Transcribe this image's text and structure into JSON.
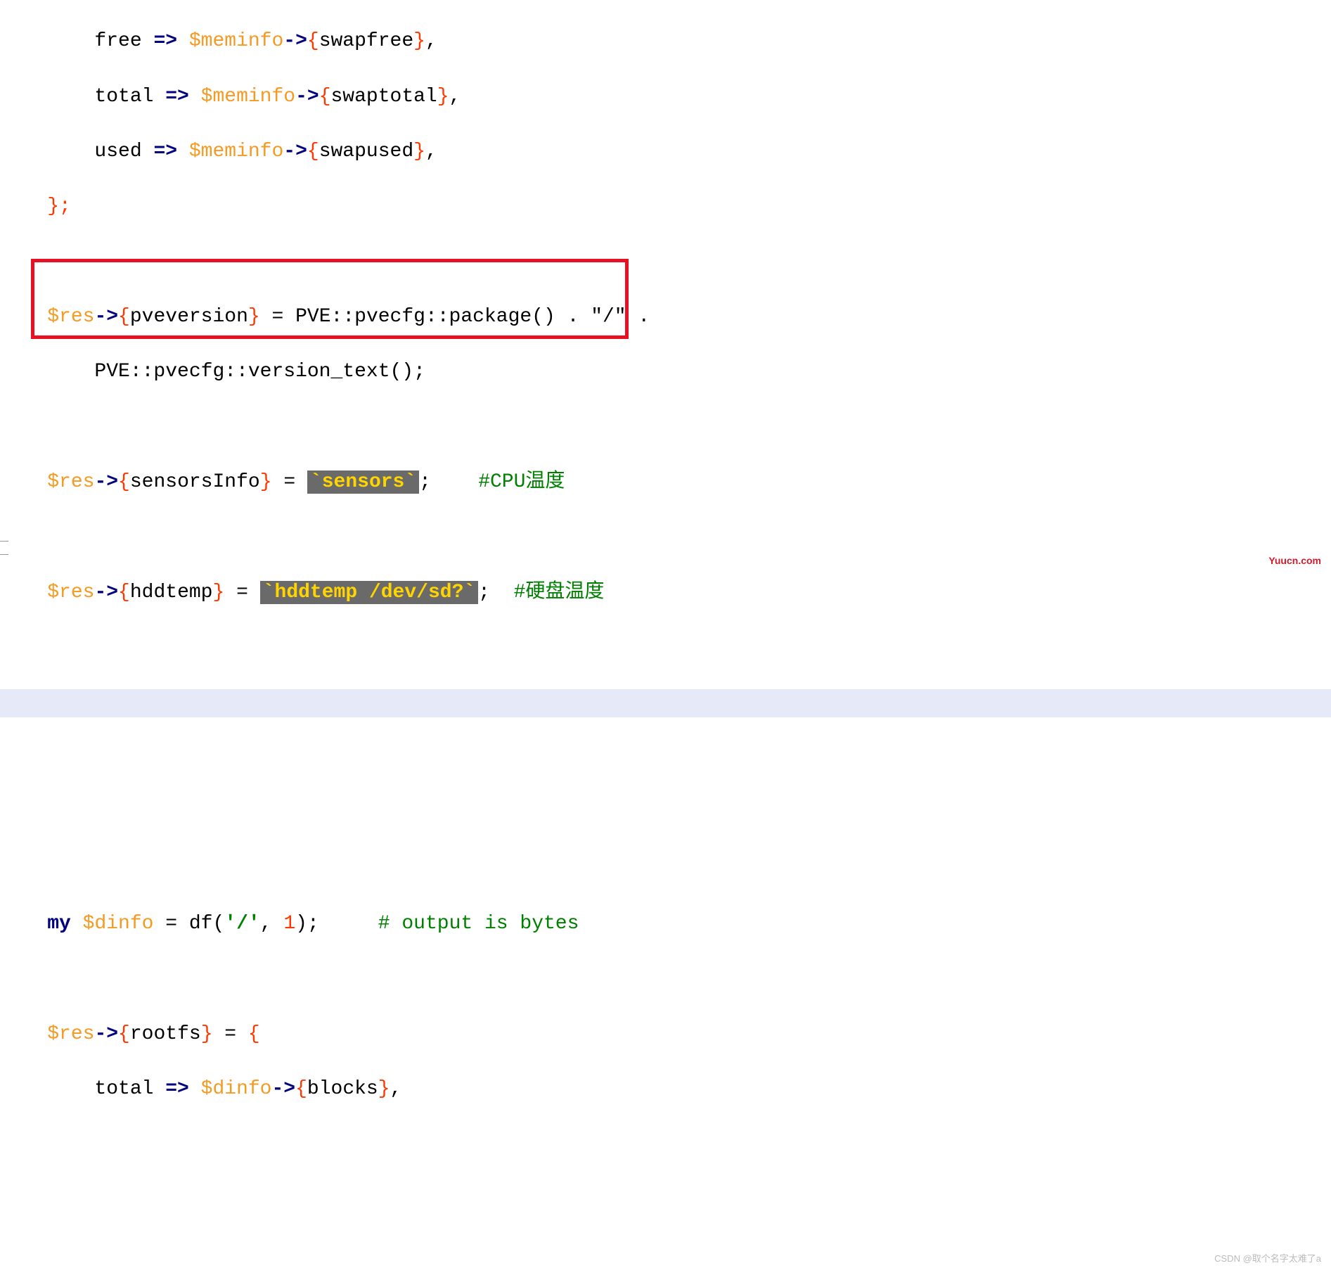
{
  "code": {
    "l01_indent": "        ",
    "l01_key": "free",
    "l01_arrow": " => ",
    "l01_var": "$meminfo",
    "l01_arrow2": "->",
    "l01_brace_o": "{",
    "l01_field": "swapfree",
    "l01_brace_c": "}",
    "l01_comma": ",",
    "l02_key": "total",
    "l02_field": "swaptotal",
    "l03_key": "used",
    "l03_field": "swapused",
    "l04_indent": "    ",
    "l04_close": "};",
    "l06_indent": "    ",
    "l06_var": "$res",
    "l06_arrow": "->",
    "l06_brace_o": "{",
    "l06_field": "pveversion",
    "l06_brace_c": "}",
    "l06_eq": " = ",
    "l06_rest": "PVE::pvecfg::package() . \"/\" .",
    "l07_indent": "        ",
    "l07_text": "PVE::pvecfg::version_text();",
    "l09_field": "sensorsInfo",
    "l09_eq": " = ",
    "l09_cmd": "`sensors`",
    "l09_semi": ";",
    "l09_spaces": "    ",
    "l09_comment": "#CPU温度",
    "l11_field": "hddtemp",
    "l11_cmd": "`hddtemp /dev/sd?`",
    "l11_semi": ";",
    "l11_spaces": "  ",
    "l11_comment": "#硬盘温度",
    "l15_indent": "    ",
    "l15_my": "my",
    "l15_sp": " ",
    "l15_var": "$dinfo",
    "l15_eq": " = df(",
    "l15_str": "'/'",
    "l15_comma": ", ",
    "l15_num": "1",
    "l15_close": ");",
    "l15_spaces": "     ",
    "l15_comment": "# output is bytes",
    "l17_field": "rootfs",
    "l17_eq": " = ",
    "l17_open": "{",
    "l18_key": "total",
    "l18_var": "$dinfo",
    "l18_field": "blocks"
  },
  "watermark_main": "Yuucn.com",
  "watermark_sub": "CSDN @取个名字太难了a"
}
